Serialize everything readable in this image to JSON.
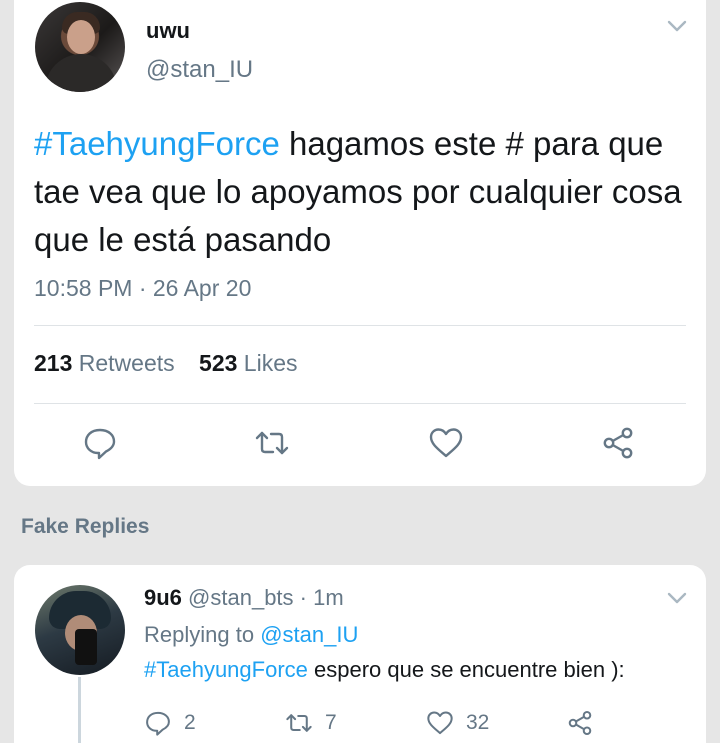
{
  "tweet": {
    "author_name": "uwu",
    "author_handle": "@stan_IU",
    "hashtag": "#TaehyungForce",
    "text_rest": " hagamos este # para que tae vea que lo apoyamos por cualquier cosa que le está pasando",
    "timestamp": "10:58 PM · 26 Apr 20",
    "retweets_count": "213",
    "retweets_label": "Retweets",
    "likes_count": "523",
    "likes_label": "Likes"
  },
  "section": {
    "title": "Fake Replies"
  },
  "reply": {
    "author_name": "9u6",
    "author_handle": "@stan_bts",
    "separator": " · ",
    "time": "1m",
    "replying_prefix": "Replying to ",
    "replying_to": "@stan_IU",
    "hashtag": "#TaehyungForce",
    "text_rest": " espero que se encuentre bien ):",
    "reply_count": "2",
    "retweet_count": "7",
    "like_count": "32"
  },
  "icons": {
    "reply": "comment-icon",
    "retweet": "retweet-icon",
    "like": "heart-icon",
    "share": "share-icon",
    "menu": "chevron-down-icon"
  },
  "colors": {
    "accent": "#1da1f2",
    "secondary_text": "#657786",
    "primary_text": "#14171a",
    "background": "#e6e6e6"
  }
}
